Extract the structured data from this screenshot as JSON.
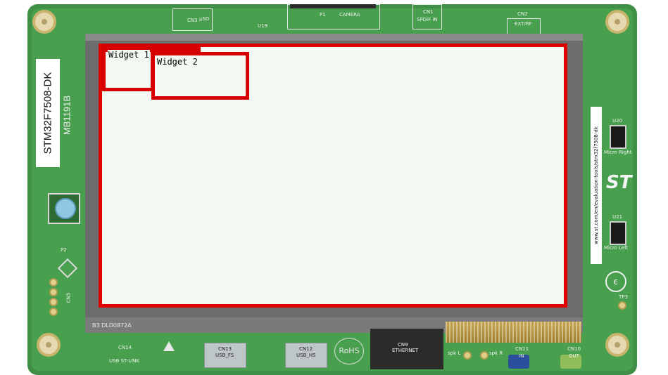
{
  "board": {
    "name": "STM32F7508-DK",
    "part_number": "MB1191B",
    "url": "www.st.com/en/evaluation-tools/stm32f7508-dk",
    "display_code": "B3 DLD0872A",
    "rohs": "RoHS"
  },
  "silkscreen": {
    "cn3": "CN3",
    "usd": "µSD",
    "u19": "U19",
    "p1": "P1",
    "camera": "CAMERA",
    "cn1": "CN1",
    "spdif": "SPDIF IN",
    "cn2": "CN2",
    "ext_rf": "EXT/RF",
    "u20": "U20",
    "micro_right": "Micro Right",
    "u21": "U21",
    "micro_left": "Micro Left",
    "tp3": "TP3",
    "cn14": "CN14",
    "usb_st_link": "USB ST-LINK",
    "cn13": "CN13",
    "usb_fs": "USB_FS",
    "cn12": "CN12",
    "usb_hs": "USB_HS",
    "cn9": "CN9",
    "ethernet": "ETHERNET",
    "spk_l": "spk L",
    "spk_r": "spk R",
    "cn11": "CN11",
    "in": "IN",
    "cn10": "CN10",
    "out": "OUT",
    "p2": "P2",
    "cn5": "CN5"
  },
  "screen": {
    "widgets": [
      {
        "title": "Widget 1"
      },
      {
        "title": "Widget 2"
      }
    ]
  },
  "colors": {
    "pcb": "#48a04f",
    "frame": "#e00000",
    "widget_border": "#d60000",
    "screen_bg": "#f4f9f4",
    "button": "#8fc7e3"
  }
}
